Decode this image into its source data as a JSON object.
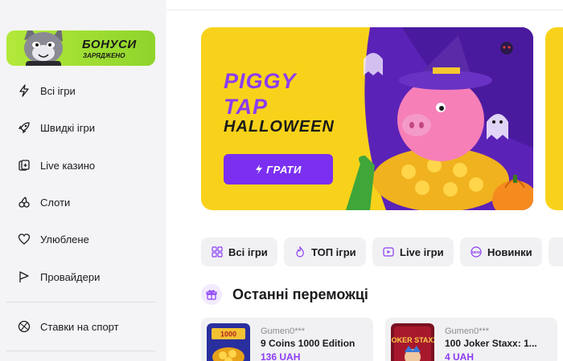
{
  "sidebar": {
    "bonus": {
      "title": "БОНУСИ",
      "subtitle": "ЗАРЯДЖЕНО"
    },
    "items": [
      {
        "label": "Всі ігри",
        "icon": "lightning-icon"
      },
      {
        "label": "Швидкі ігри",
        "icon": "rocket-icon"
      },
      {
        "label": "Live казино",
        "icon": "cards-icon"
      },
      {
        "label": "Слоти",
        "icon": "cherries-icon"
      },
      {
        "label": "Улюблене",
        "icon": "heart-icon"
      },
      {
        "label": "Провайдери",
        "icon": "flag-icon"
      }
    ],
    "sport": {
      "label": "Ставки на спорт",
      "icon": "ball-icon"
    }
  },
  "banner": {
    "title_line1": "PIGGY",
    "title_line2": "TAP",
    "title_line3": "HALLOWEEN",
    "button": "ГРАТИ"
  },
  "chips": [
    {
      "label": "Всі ігри",
      "icon": "grid-icon"
    },
    {
      "label": "ТОП ігри",
      "icon": "fire-icon"
    },
    {
      "label": "Live ігри",
      "icon": "play-icon"
    },
    {
      "label": "Новинки",
      "icon": "new-badge-icon"
    }
  ],
  "recent_wins": {
    "title": "Останні переможці",
    "items": [
      {
        "user": "Gumen0***",
        "game": "9 Coins 1000 Edition",
        "amount": "136 UAH",
        "thumb_text": "1000"
      },
      {
        "user": "Gumen0***",
        "game": "100 Joker Staxx: 1...",
        "amount": "4 UAH",
        "thumb_text": "JOKER STAXX"
      }
    ]
  },
  "colors": {
    "accent": "#8b3cf2",
    "banner_bg": "#f8d21a",
    "bonus_bg": "#a6e135"
  }
}
